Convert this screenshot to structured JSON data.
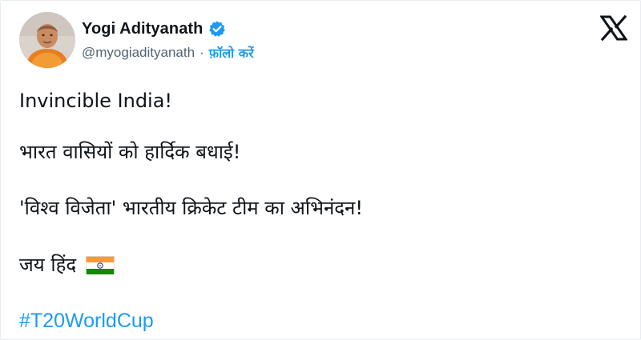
{
  "author": {
    "name": "Yogi Adityanath",
    "handle": "@myogiadityanath",
    "separator": "·",
    "follow_label": "फ़ॉलो करें",
    "verified": true
  },
  "tweet": {
    "lines": [
      "Invincible India!",
      "भारत वासियों को हार्दिक बधाई!",
      "'विश्व विजेता' भारतीय क्रिकेट टीम का अभिनंदन!",
      "जय हिंद"
    ],
    "flag_emoji": "india-flag-icon",
    "hashtag": "#T20WorldCup"
  },
  "colors": {
    "text": "#0f1419",
    "secondary": "#536471",
    "accent": "#1d9bf0"
  },
  "icons": {
    "verified": "verified-badge-icon",
    "platform": "x-logo-icon"
  }
}
